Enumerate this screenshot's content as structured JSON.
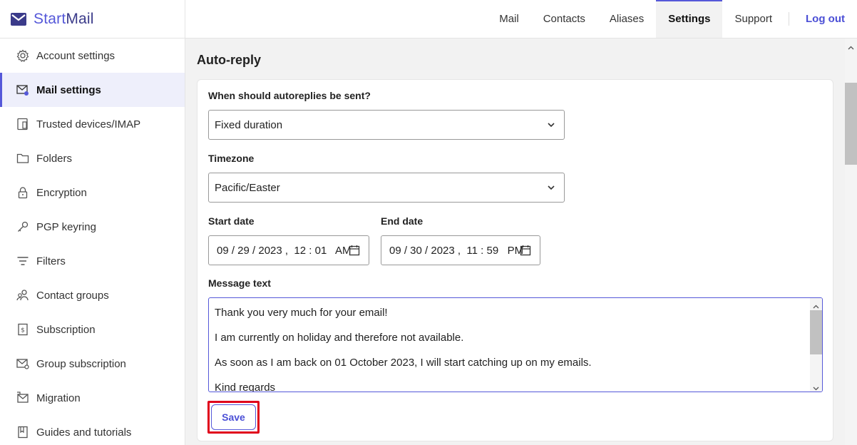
{
  "brand": {
    "name_part1": "Start",
    "name_part2": "Mail"
  },
  "sidebar": {
    "items": [
      {
        "label": "Account settings",
        "icon": "gear-icon"
      },
      {
        "label": "Mail settings",
        "icon": "mail-gear-icon",
        "active": true
      },
      {
        "label": "Trusted devices/IMAP",
        "icon": "devices-icon"
      },
      {
        "label": "Folders",
        "icon": "folder-icon"
      },
      {
        "label": "Encryption",
        "icon": "lock-icon"
      },
      {
        "label": "PGP keyring",
        "icon": "key-icon"
      },
      {
        "label": "Filters",
        "icon": "filter-icon"
      },
      {
        "label": "Contact groups",
        "icon": "contact-group-icon"
      },
      {
        "label": "Subscription",
        "icon": "receipt-icon"
      },
      {
        "label": "Group subscription",
        "icon": "mail-group-icon"
      },
      {
        "label": "Migration",
        "icon": "migration-icon"
      },
      {
        "label": "Guides and tutorials",
        "icon": "book-icon"
      }
    ]
  },
  "topnav": {
    "tabs": [
      "Mail",
      "Contacts",
      "Aliases",
      "Settings",
      "Support"
    ],
    "active": "Settings",
    "logout": "Log out"
  },
  "autoreply": {
    "title": "Auto-reply",
    "when_label": "When should autoreplies be sent?",
    "when_value": "Fixed duration",
    "timezone_label": "Timezone",
    "timezone_value": "Pacific/Easter",
    "start_label": "Start date",
    "start_value": "09 / 29 / 2023 ,  12 : 01   AM",
    "end_label": "End date",
    "end_value": "09 / 30 / 2023 ,  11 : 59   PM",
    "message_label": "Message text",
    "message_lines": [
      "Thank you very much for your email!",
      "I am currently on holiday and therefore not available.",
      "As soon as I am back on 01 October 2023, I will start catching up on my emails.",
      "Kind regards"
    ],
    "save_label": "Save"
  },
  "colors": {
    "accent": "#5558d9",
    "highlight": "#e0001b"
  }
}
